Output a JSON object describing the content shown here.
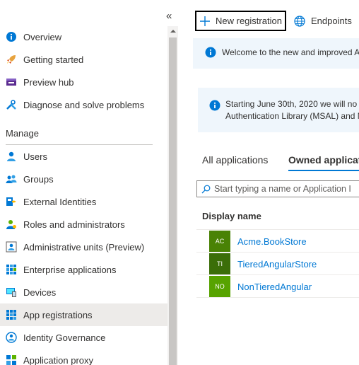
{
  "nav": {
    "collapse_glyph": "«",
    "items_top": [
      {
        "label": "Overview",
        "icon": "info-icon"
      },
      {
        "label": "Getting started",
        "icon": "rocket-icon"
      },
      {
        "label": "Preview hub",
        "icon": "preview-hub-icon"
      },
      {
        "label": "Diagnose and solve problems",
        "icon": "wrench-icon"
      }
    ],
    "manage_header": "Manage",
    "items_manage": [
      {
        "label": "Users",
        "icon": "user-icon"
      },
      {
        "label": "Groups",
        "icon": "groups-icon"
      },
      {
        "label": "External Identities",
        "icon": "external-identities-icon"
      },
      {
        "label": "Roles and administrators",
        "icon": "roles-icon"
      },
      {
        "label": "Administrative units (Preview)",
        "icon": "admin-units-icon"
      },
      {
        "label": "Enterprise applications",
        "icon": "enterprise-apps-icon"
      },
      {
        "label": "Devices",
        "icon": "devices-icon"
      },
      {
        "label": "App registrations",
        "icon": "app-registrations-icon",
        "selected": true
      },
      {
        "label": "Identity Governance",
        "icon": "identity-governance-icon"
      },
      {
        "label": "Application proxy",
        "icon": "application-proxy-icon"
      }
    ]
  },
  "toolbar": {
    "new_registration": "New registration",
    "endpoints": "Endpoints"
  },
  "banners": {
    "welcome": "Welcome to the new and improved A",
    "notice_line1": "Starting June 30th, 2020 we will no l",
    "notice_line2": "Authentication Library (MSAL) and M"
  },
  "tabs": {
    "all": "All applications",
    "owned": "Owned applicat"
  },
  "search": {
    "placeholder": "Start typing a name or Application I"
  },
  "table": {
    "header": "Display name",
    "rows": [
      {
        "initials": "AC",
        "name": "Acme.BookStore",
        "color": "#498205"
      },
      {
        "initials": "TI",
        "name": "TieredAngularStore",
        "color": "#3b6e09"
      },
      {
        "initials": "NO",
        "name": "NonTieredAngular",
        "color": "#57a300"
      }
    ]
  },
  "colors": {
    "accent": "#0078d4",
    "banner_bg": "#eff6fc",
    "selected_bg": "#edebe9"
  }
}
